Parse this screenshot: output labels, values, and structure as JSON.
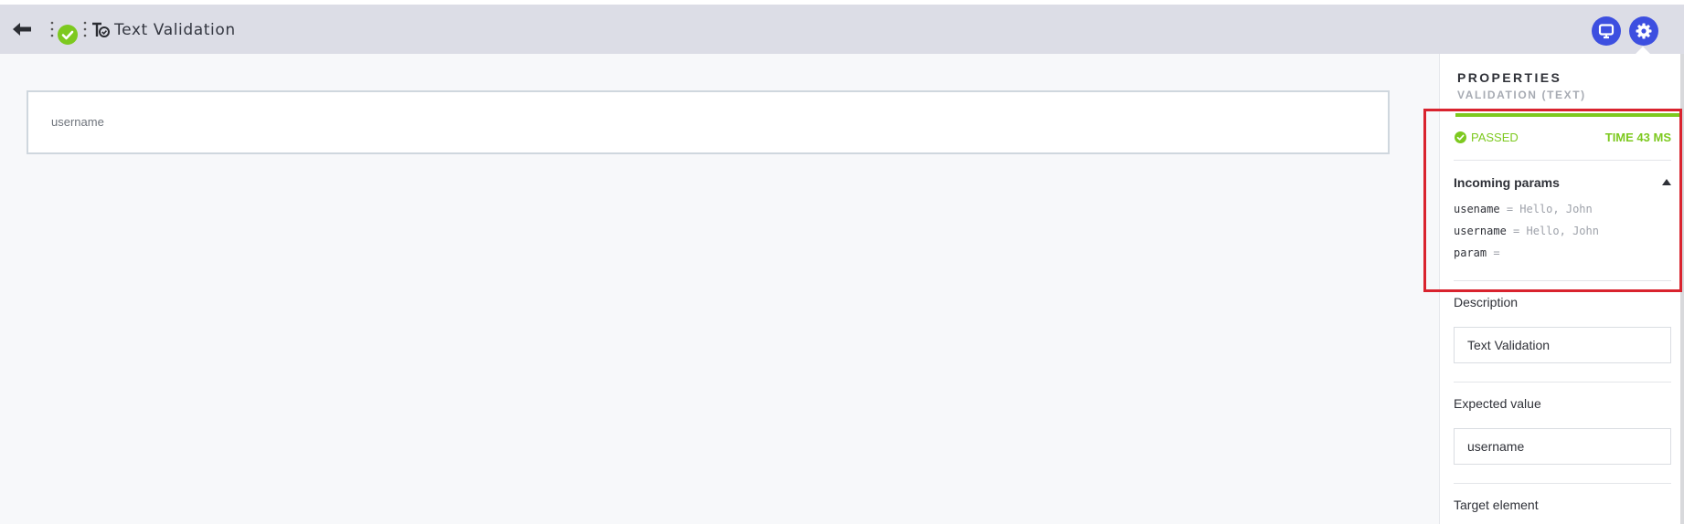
{
  "header": {
    "title": "Text Validation"
  },
  "canvas": {
    "element_text": "username"
  },
  "panel": {
    "title": "PROPERTIES",
    "subtitle": "VALIDATION (TEXT)",
    "status": "PASSED",
    "time": "TIME 43 MS",
    "incoming_params": {
      "heading": "Incoming params",
      "params": [
        {
          "name": "usename",
          "eq": "=",
          "value": "Hello, John"
        },
        {
          "name": "username",
          "eq": "=",
          "value": "Hello, John"
        },
        {
          "name": "param",
          "eq": "=",
          "value": ""
        }
      ]
    },
    "description": {
      "label": "Description",
      "value": "Text Validation"
    },
    "expected_value": {
      "label": "Expected value",
      "value": "username"
    },
    "target_element": {
      "label": "Target element"
    }
  },
  "colors": {
    "accent": "#3d4fe0",
    "success": "#7dc91f",
    "highlight": "#d9232e",
    "topbar": "#dcdde6"
  },
  "icons": {
    "back": "arrow-left-icon",
    "status": "check-circle-icon",
    "type": "text-validation-icon",
    "monitor": "monitor-icon",
    "settings": "gear-icon"
  }
}
